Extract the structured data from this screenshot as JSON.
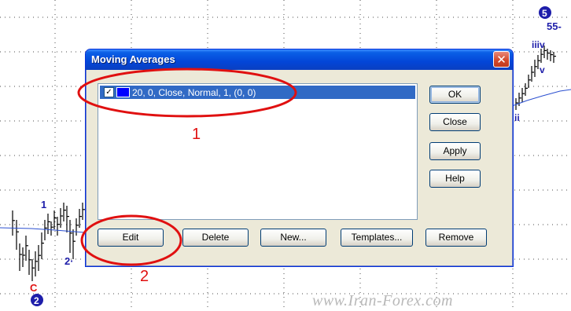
{
  "dialog": {
    "title": "Moving Averages",
    "close_glyph": "✕",
    "list": {
      "items": [
        {
          "checked": true,
          "swatch_color": "#0000ff",
          "text": "20, 0, Close, Normal, 1, (0, 0)"
        }
      ]
    },
    "buttons": {
      "ok": "OK",
      "close": "Close",
      "apply": "Apply",
      "help": "Help",
      "edit": "Edit",
      "delete": "Delete",
      "new": "New...",
      "templates": "Templates...",
      "remove": "Remove"
    }
  },
  "annotations": {
    "one": "1",
    "two": "2"
  },
  "chart_labels": {
    "top_circle": "5",
    "top_number": "55-",
    "iiiv": "iiiv",
    "v": "v",
    "ii": "ii",
    "left_1": "1",
    "left_2": "2·",
    "c": "C",
    "bottom_circle": "2"
  },
  "watermark": "www.Iran-Forex.com",
  "colors": {
    "accent": "#0346d8",
    "annotation_red": "#e01010",
    "wave_blue": "#1e1eaa",
    "selection": "#316ac5"
  }
}
